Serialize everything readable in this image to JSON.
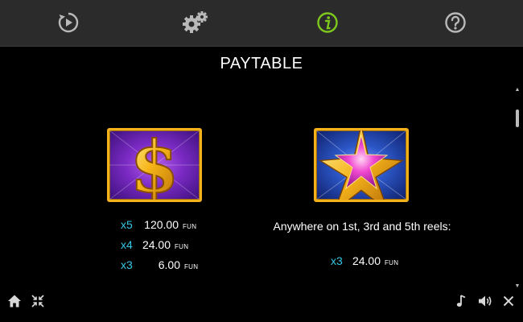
{
  "toolbar": {
    "icons": [
      "autoplay-icon",
      "settings-icon",
      "info-icon",
      "help-icon"
    ],
    "active_icon": "info-icon",
    "active_color": "#7ec81e",
    "icon_color": "#b9b9b9"
  },
  "paytable": {
    "title": "PAYTABLE",
    "symbols": [
      {
        "icon": "dollar-symbol-icon",
        "payouts": [
          {
            "multiplier": "x5",
            "amount": "120.00",
            "currency": "FUN"
          },
          {
            "multiplier": "x4",
            "amount": "24.00",
            "currency": "FUN"
          },
          {
            "multiplier": "x3",
            "amount": "6.00",
            "currency": "FUN"
          }
        ]
      },
      {
        "icon": "star-symbol-icon",
        "condition": "Anywhere on 1st, 3rd and 5th reels:",
        "payouts": [
          {
            "multiplier": "x3",
            "amount": "24.00",
            "currency": "FUN"
          }
        ]
      }
    ]
  },
  "colors": {
    "multiplier": "#35c8e6",
    "frame_gold": "#f3b21c"
  },
  "bottom_bar": {
    "left_icons": [
      "home-icon",
      "exit-fullscreen-icon"
    ],
    "right_icons": [
      "music-icon",
      "sound-icon",
      "close-icon"
    ]
  }
}
